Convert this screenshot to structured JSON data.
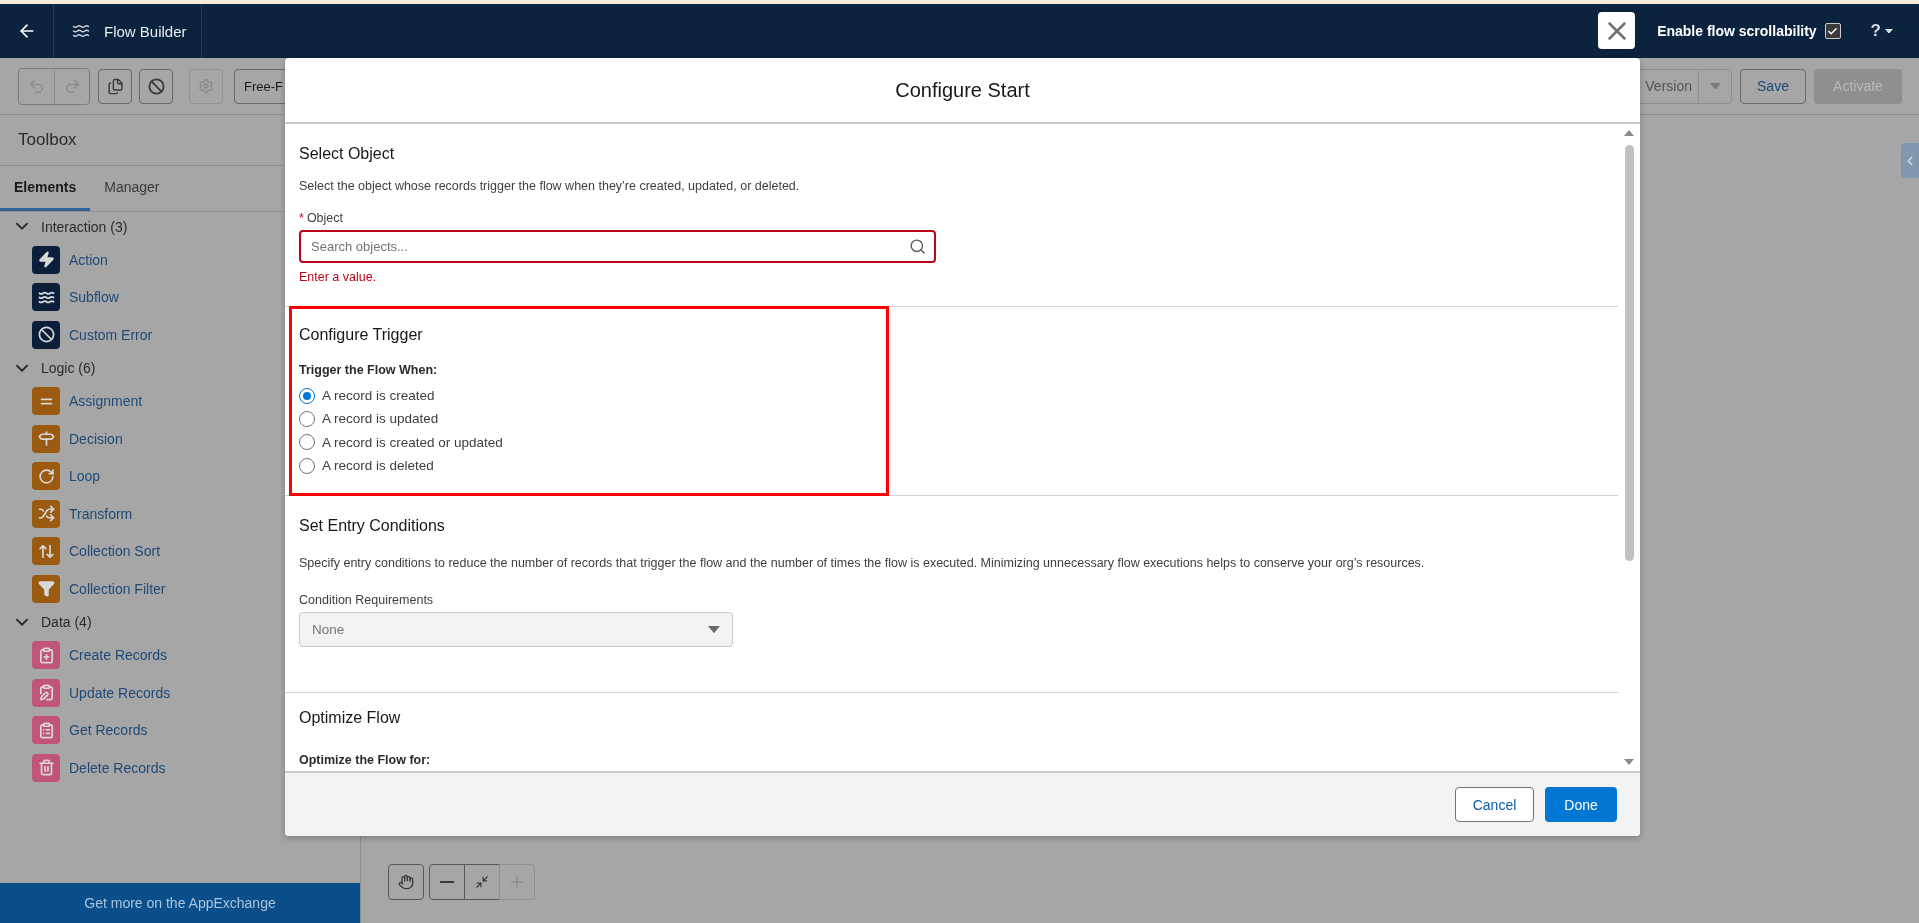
{
  "header": {
    "app_title": "Flow Builder",
    "scrollability": {
      "label": "Enable flow scrollability",
      "checked": true
    },
    "help": "?"
  },
  "toolbar": {
    "mode_button": "Free-F",
    "version_button": "Version",
    "save": "Save",
    "activate": {
      "label": "Activate",
      "disabled": true
    }
  },
  "toolbox": {
    "title": "Toolbox",
    "tabs": [
      {
        "label": "Elements",
        "selected": true
      },
      {
        "label": "Manager",
        "selected": false
      }
    ],
    "groups": [
      {
        "label": "Interaction (3)",
        "kind": "interaction",
        "expanded": true,
        "children": [
          {
            "label": "Action",
            "kind": "action"
          },
          {
            "label": "Subflow",
            "kind": "subflow"
          },
          {
            "label": "Custom Error",
            "kind": "error"
          }
        ]
      },
      {
        "label": "Logic (6)",
        "kind": "logic",
        "expanded": true,
        "children": [
          {
            "label": "Assignment",
            "kind": "assignment"
          },
          {
            "label": "Decision",
            "kind": "decision"
          },
          {
            "label": "Loop",
            "kind": "loop"
          },
          {
            "label": "Transform",
            "kind": "transform"
          },
          {
            "label": "Collection Sort",
            "kind": "sort"
          },
          {
            "label": "Collection Filter",
            "kind": "filter"
          }
        ]
      },
      {
        "label": "Data (4)",
        "kind": "data",
        "expanded": true,
        "children": [
          {
            "label": "Create Records",
            "kind": "create"
          },
          {
            "label": "Update Records",
            "kind": "update"
          },
          {
            "label": "Get Records",
            "kind": "get"
          },
          {
            "label": "Delete Records",
            "kind": "delete"
          }
        ]
      }
    ],
    "footer_link": "Get more on the AppExchange"
  },
  "modal": {
    "title": "Configure Start",
    "select_object": {
      "title": "Select Object",
      "description": "Select the object whose records trigger the flow when they’re created, updated, or deleted.",
      "field": {
        "required_mark": "*",
        "label": "Object",
        "placeholder": "Search objects...",
        "error": "Enter a value."
      }
    },
    "configure_trigger": {
      "title": "Configure Trigger",
      "highlighted": true,
      "question": "Trigger the Flow When:",
      "options": [
        {
          "label": "A record is created",
          "selected": true
        },
        {
          "label": "A record is updated",
          "selected": false
        },
        {
          "label": "A record is created or updated",
          "selected": false
        },
        {
          "label": "A record is deleted",
          "selected": false
        }
      ]
    },
    "entry_conditions": {
      "title": "Set Entry Conditions",
      "description": "Specify entry conditions to reduce the number of records that trigger the flow and the number of times the flow is executed. Minimizing unnecessary flow executions helps to conserve your org’s resources.",
      "select_label": "Condition Requirements",
      "select_value": "None"
    },
    "optimize": {
      "title": "Optimize Flow",
      "question": "Optimize the Flow for:"
    },
    "footer": {
      "cancel": "Cancel",
      "done": "Done"
    }
  }
}
